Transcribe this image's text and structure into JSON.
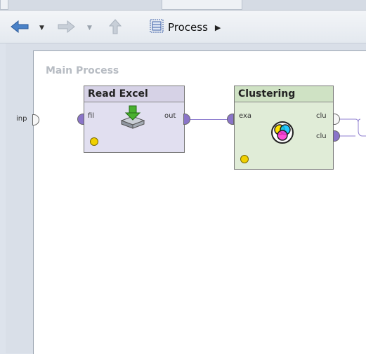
{
  "toolbar": {
    "back_icon": "back-arrow-icon",
    "forward_icon": "forward-arrow-icon",
    "up_icon": "up-arrow-icon",
    "breadcrumb": {
      "label": "Process",
      "icon": "process-icon"
    }
  },
  "canvas": {
    "title": "Main Process",
    "input_port_label": "inp",
    "operators": [
      {
        "name": "Read Excel",
        "icon": "read-excel-icon",
        "inputs": [
          {
            "label": "fil"
          }
        ],
        "outputs": [
          {
            "label": "out"
          }
        ]
      },
      {
        "name": "Clustering",
        "icon": "clustering-icon",
        "inputs": [
          {
            "label": "exa"
          }
        ],
        "outputs": [
          {
            "label": "clu"
          },
          {
            "label": "clu"
          }
        ]
      }
    ]
  },
  "colors": {
    "read_excel_header": "#d6d2e6",
    "read_excel_body": "#e1dff0",
    "clustering_header": "#cfe2c4",
    "clustering_body": "#e0ecd7",
    "status_dot": "#f0d000",
    "connection": "#8f7fd0"
  }
}
